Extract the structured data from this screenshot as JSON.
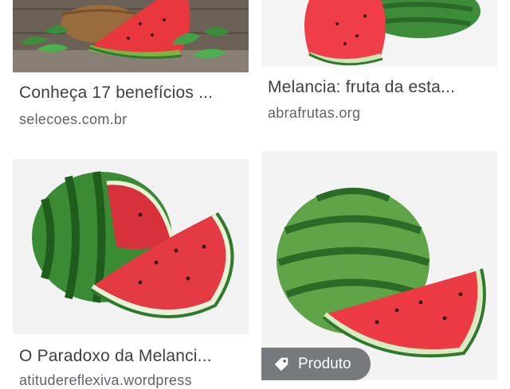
{
  "results": [
    {
      "title": "Conheça 17 benefícios ...",
      "source": "selecoes.com.br"
    },
    {
      "title": "Melancia: fruta da esta...",
      "source": "abrafrutas.org"
    },
    {
      "title": "O Paradoxo da Melanci...",
      "source": "atitudereflexiva.wordpress"
    },
    {
      "badge": "Produto"
    }
  ],
  "colors": {
    "watermelon_red": "#e8383d",
    "rind_green": "#2f7a2c",
    "title_text": "#3c4043",
    "source_text": "#5f6368"
  },
  "icons": {
    "badge_icon": "tag-icon"
  }
}
